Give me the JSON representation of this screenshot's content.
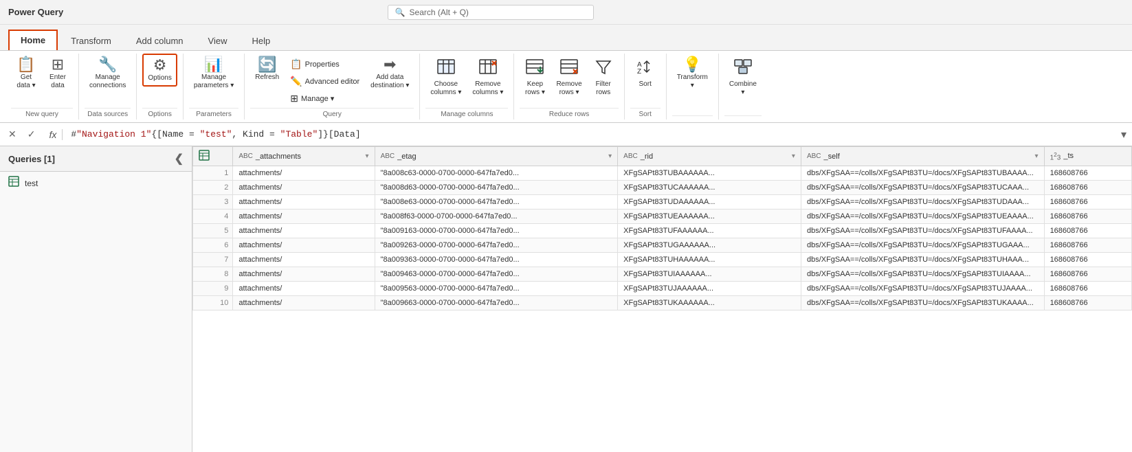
{
  "titleBar": {
    "title": "Power Query",
    "searchPlaceholder": "Search (Alt + Q)"
  },
  "tabs": [
    {
      "id": "home",
      "label": "Home",
      "active": true
    },
    {
      "id": "transform",
      "label": "Transform",
      "active": false
    },
    {
      "id": "add-column",
      "label": "Add column",
      "active": false
    },
    {
      "id": "view",
      "label": "View",
      "active": false
    },
    {
      "id": "help",
      "label": "Help",
      "active": false
    }
  ],
  "ribbon": {
    "groups": [
      {
        "id": "new-query",
        "label": "New query",
        "items": [
          {
            "id": "get-data",
            "label": "Get\ndata ∨",
            "icon": "📋"
          },
          {
            "id": "enter-data",
            "label": "Enter\ndata",
            "icon": "⊞"
          }
        ]
      },
      {
        "id": "data-sources",
        "label": "Data sources",
        "items": [
          {
            "id": "manage-connections",
            "label": "Manage\nconnections",
            "icon": "🔧"
          }
        ]
      },
      {
        "id": "options-group",
        "label": "Options",
        "items": [
          {
            "id": "options",
            "label": "Options",
            "icon": "⚙",
            "highlighted": true
          }
        ]
      },
      {
        "id": "parameters",
        "label": "Parameters",
        "items": [
          {
            "id": "manage-parameters",
            "label": "Manage\nparameters ∨",
            "icon": "📊"
          }
        ]
      },
      {
        "id": "query",
        "label": "Query",
        "items": [
          {
            "id": "refresh",
            "label": "Refresh",
            "icon": "🔄"
          },
          {
            "id": "properties-group",
            "label": "",
            "icon": ""
          },
          {
            "id": "add-data-destination",
            "label": "Add data\ndestination ∨",
            "icon": "➡"
          }
        ],
        "smallItems": [
          {
            "id": "properties",
            "label": "Properties",
            "icon": "📋"
          },
          {
            "id": "advanced-editor",
            "label": "Advanced editor",
            "icon": "🖊"
          },
          {
            "id": "manage",
            "label": "Manage ∨",
            "icon": "⊞"
          }
        ]
      },
      {
        "id": "manage-columns",
        "label": "Manage columns",
        "items": [
          {
            "id": "choose-columns",
            "label": "Choose\ncolumns ∨",
            "icon": "⊞"
          },
          {
            "id": "remove-columns",
            "label": "Remove\ncolumns ∨",
            "icon": "✗"
          }
        ]
      },
      {
        "id": "reduce-rows",
        "label": "Reduce rows",
        "items": [
          {
            "id": "keep-rows",
            "label": "Keep\nrows ∨",
            "icon": "↓"
          },
          {
            "id": "remove-rows",
            "label": "Remove\nrows ∨",
            "icon": "✕"
          },
          {
            "id": "filter-rows",
            "label": "Filter\nrows",
            "icon": "▽"
          }
        ]
      },
      {
        "id": "sort",
        "label": "Sort",
        "items": [
          {
            "id": "sort-az",
            "label": "",
            "icon": "↕"
          }
        ]
      },
      {
        "id": "transform-group",
        "label": "",
        "items": [
          {
            "id": "transform-btn",
            "label": "Transform\n∨",
            "icon": "💡"
          }
        ]
      },
      {
        "id": "combine-group",
        "label": "",
        "items": [
          {
            "id": "combine-btn",
            "label": "Combine\n∨",
            "icon": "⊞"
          }
        ]
      }
    ]
  },
  "formulaBar": {
    "formula": "#\"Navigation 1\"{[Name = \"test\", Kind = \"Table\"]}[Data]",
    "formulaColored": "#\"Navigation 1\"{[Name = <red>\"test\"</red>, Kind = <red>\"Table\"</red>]}[Data]"
  },
  "sidebar": {
    "title": "Queries [1]",
    "queries": [
      {
        "id": "test",
        "label": "test",
        "icon": "table"
      }
    ]
  },
  "grid": {
    "columns": [
      {
        "id": "row-num",
        "label": "",
        "type": ""
      },
      {
        "id": "_attachments",
        "label": "_attachments",
        "type": "ABC"
      },
      {
        "id": "_etag",
        "label": "_etag",
        "type": "ABC"
      },
      {
        "id": "_rid",
        "label": "_rid",
        "type": "ABC"
      },
      {
        "id": "_self",
        "label": "_self",
        "type": "ABC"
      },
      {
        "id": "_ts",
        "label": "_ts",
        "type": "123"
      }
    ],
    "rows": [
      {
        "num": 1,
        "_attachments": "attachments/",
        "_etag": "\"8a008c63-0000-0700-0000-647fa7ed0...",
        "_rid": "XFgSAPt83TUBAAAAAA...",
        "_self": "dbs/XFgSAA==/colls/XFgSAPt83TU=/docs/XFgSAPt83TUBAAAA...",
        "_ts": "168608766"
      },
      {
        "num": 2,
        "_attachments": "attachments/",
        "_etag": "\"8a008d63-0000-0700-0000-647fa7ed0...",
        "_rid": "XFgSAPt83TUCAAAAAA...",
        "_self": "dbs/XFgSAA==/colls/XFgSAPt83TU=/docs/XFgSAPt83TUCAAA...",
        "_ts": "168608766"
      },
      {
        "num": 3,
        "_attachments": "attachments/",
        "_etag": "\"8a008e63-0000-0700-0000-647fa7ed0...",
        "_rid": "XFgSAPt83TUDAAAAAA...",
        "_self": "dbs/XFgSAA==/colls/XFgSAPt83TU=/docs/XFgSAPt83TUDAAA...",
        "_ts": "168608766"
      },
      {
        "num": 4,
        "_attachments": "attachments/",
        "_etag": "\"8a008f63-0000-0700-0000-647fa7ed0...",
        "_rid": "XFgSAPt83TUEAAAAAA...",
        "_self": "dbs/XFgSAA==/colls/XFgSAPt83TU=/docs/XFgSAPt83TUEAAAA...",
        "_ts": "168608766"
      },
      {
        "num": 5,
        "_attachments": "attachments/",
        "_etag": "\"8a009163-0000-0700-0000-647fa7ed0...",
        "_rid": "XFgSAPt83TUFAAAAAA...",
        "_self": "dbs/XFgSAA==/colls/XFgSAPt83TU=/docs/XFgSAPt83TUFAAAA...",
        "_ts": "168608766"
      },
      {
        "num": 6,
        "_attachments": "attachments/",
        "_etag": "\"8a009263-0000-0700-0000-647fa7ed0...",
        "_rid": "XFgSAPt83TUGAAAAAA...",
        "_self": "dbs/XFgSAA==/colls/XFgSAPt83TU=/docs/XFgSAPt83TUGAAA...",
        "_ts": "168608766"
      },
      {
        "num": 7,
        "_attachments": "attachments/",
        "_etag": "\"8a009363-0000-0700-0000-647fa7ed0...",
        "_rid": "XFgSAPt83TUHAAAAAA...",
        "_self": "dbs/XFgSAA==/colls/XFgSAPt83TU=/docs/XFgSAPt83TUHAAA...",
        "_ts": "168608766"
      },
      {
        "num": 8,
        "_attachments": "attachments/",
        "_etag": "\"8a009463-0000-0700-0000-647fa7ed0...",
        "_rid": "XFgSAPt83TUIAAAAAA...",
        "_self": "dbs/XFgSAA==/colls/XFgSAPt83TU=/docs/XFgSAPt83TUIAAAA...",
        "_ts": "168608766"
      },
      {
        "num": 9,
        "_attachments": "attachments/",
        "_etag": "\"8a009563-0000-0700-0000-647fa7ed0...",
        "_rid": "XFgSAPt83TUJAAAAAA...",
        "_self": "dbs/XFgSAA==/colls/XFgSAPt83TU=/docs/XFgSAPt83TUJAAAA...",
        "_ts": "168608766"
      },
      {
        "num": 10,
        "_attachments": "attachments/",
        "_etag": "\"8a009663-0000-0700-0000-647fa7ed0...",
        "_rid": "XFgSAPt83TUKAAAAAA...",
        "_self": "dbs/XFgSAA==/colls/XFgSAPt83TU=/docs/XFgSAPt83TUKAAAA...",
        "_ts": "168608766"
      }
    ]
  },
  "icons": {
    "search": "🔍",
    "collapse": "❮",
    "dropdown": "▾",
    "table": "☰",
    "close": "✕",
    "check": "✓"
  }
}
